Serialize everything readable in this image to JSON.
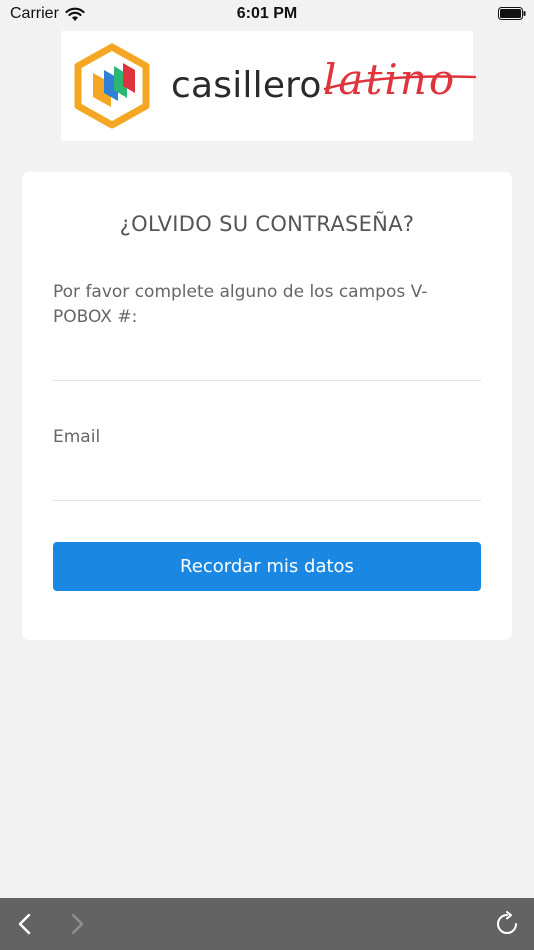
{
  "status_bar": {
    "carrier": "Carrier",
    "time": "6:01 PM"
  },
  "logo": {
    "word": "casillero",
    "script": "latino",
    "colors": {
      "hex_orange": "#f5a623",
      "accent_red": "#e0343c",
      "accent_green": "#2bb673",
      "accent_blue": "#2f80d8"
    }
  },
  "form": {
    "title": "¿OLVIDO SU CONTRASEÑA?",
    "description": "Por favor complete alguno de los campos V-POBOX #:",
    "pobox_value": "",
    "email_label": "Email",
    "email_value": "",
    "submit_label": "Recordar mis datos"
  },
  "toolbar": {
    "back_icon": "chevron-left-icon",
    "forward_icon": "chevron-right-icon",
    "reload_icon": "reload-icon"
  },
  "colors": {
    "page_bg": "#f2f2f2",
    "card_bg": "#ffffff",
    "button_bg": "#1a88e2",
    "toolbar_bg": "#636363"
  }
}
